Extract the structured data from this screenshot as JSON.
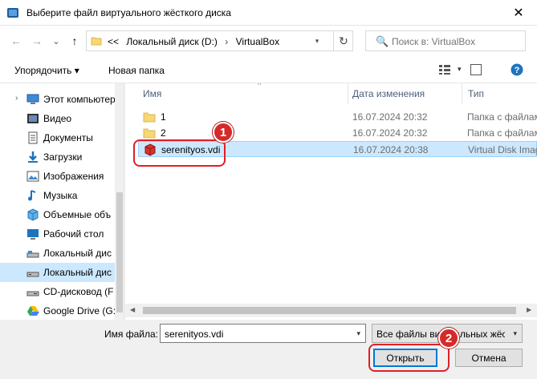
{
  "window": {
    "title": "Выберите файл виртуального жёсткого диска",
    "close_glyph": "✕"
  },
  "nav": {
    "back": "←",
    "forward": "→",
    "recent": "⌄",
    "up": "↑"
  },
  "address": {
    "overflow": "<<",
    "crumbs": [
      "Локальный диск (D:)",
      "VirtualBox"
    ],
    "separator": "›",
    "dropdown": "▾",
    "refresh": "↻"
  },
  "search": {
    "placeholder": "Поиск в: VirtualBox",
    "icon": "🔍"
  },
  "toolbar": {
    "organize": "Упорядочить ▾",
    "new_folder": "Новая папка",
    "view_dropdown": "▾"
  },
  "sidebar": {
    "items": [
      {
        "label": "Этот компьютер",
        "icon": "computer-icon",
        "expander": "›"
      },
      {
        "label": "Видео",
        "icon": "video-icon"
      },
      {
        "label": "Документы",
        "icon": "documents-icon"
      },
      {
        "label": "Загрузки",
        "icon": "downloads-icon"
      },
      {
        "label": "Изображения",
        "icon": "pictures-icon"
      },
      {
        "label": "Музыка",
        "icon": "music-icon"
      },
      {
        "label": "Объемные объ",
        "icon": "3d-objects-icon"
      },
      {
        "label": "Рабочий стол",
        "icon": "desktop-icon"
      },
      {
        "label": "Локальный дис",
        "icon": "drive-icon"
      },
      {
        "label": "Локальный дис",
        "icon": "drive-icon",
        "selected": true
      },
      {
        "label": "CD-дисковод (F",
        "icon": "cd-drive-icon"
      },
      {
        "label": "Google Drive (G:",
        "icon": "google-drive-icon"
      }
    ]
  },
  "columns": {
    "name": "Имя",
    "date": "Дата изменения",
    "type": "Тип",
    "sort_arrow": "^"
  },
  "files": [
    {
      "name": "1",
      "date": "16.07.2024 20:32",
      "type": "Папка с файлами",
      "icon": "folder-icon"
    },
    {
      "name": "2",
      "date": "16.07.2024 20:32",
      "type": "Папка с файлами",
      "icon": "folder-icon"
    },
    {
      "name": "serenityos.vdi",
      "date": "16.07.2024 20:38",
      "type": "Virtual Disk Image",
      "icon": "virtual-disk-icon",
      "selected": true
    }
  ],
  "scroll": {
    "left": "◀",
    "right": "▶"
  },
  "bottom": {
    "filename_label": "Имя файла:",
    "filename_value": "serenityos.vdi",
    "filter_value": "Все файлы виртуальных жёст",
    "dropdown": "▾",
    "open_label": "Открыть",
    "cancel_label": "Отмена"
  },
  "annotations": {
    "step1": "1",
    "step2": "2"
  },
  "colors": {
    "selection": "#cce8ff",
    "callout": "#e31e24",
    "folder": "#f8d775"
  }
}
